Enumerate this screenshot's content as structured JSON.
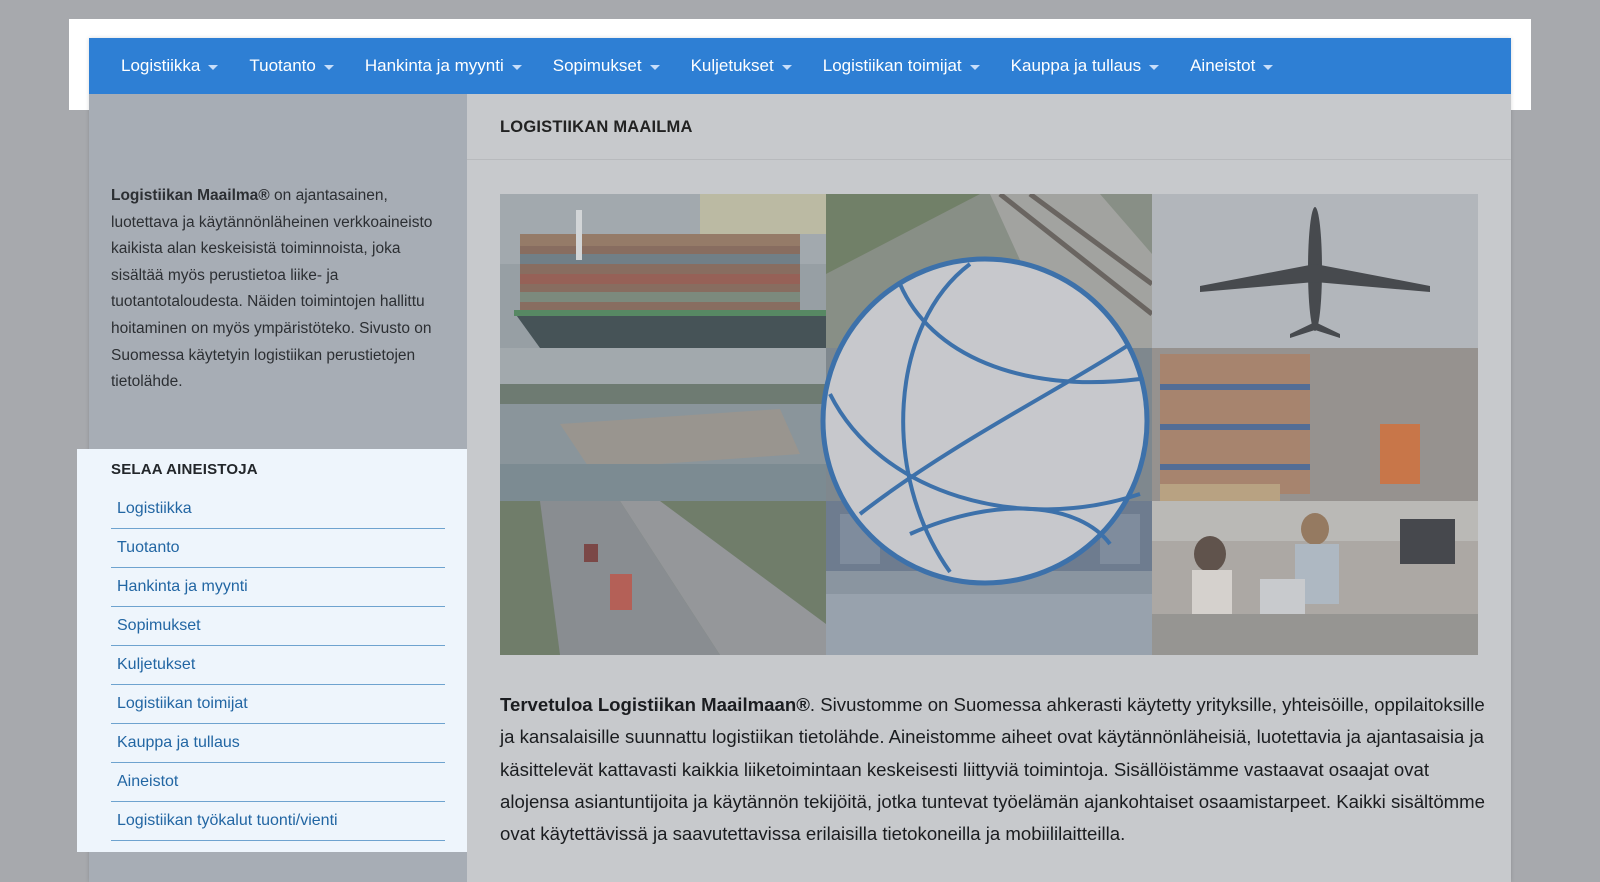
{
  "nav": {
    "items": [
      {
        "label": "Logistiikka"
      },
      {
        "label": "Tuotanto"
      },
      {
        "label": "Hankinta ja myynti"
      },
      {
        "label": "Sopimukset"
      },
      {
        "label": "Kuljetukset"
      },
      {
        "label": "Logistiikan toimijat"
      },
      {
        "label": "Kauppa ja tullaus"
      },
      {
        "label": "Aineistot"
      }
    ]
  },
  "sidebar": {
    "about_bold": "Logistiikan Maailma®",
    "about_rest": " on ajantasainen, luotettava ja käytännönläheinen verkkoaineisto kaikista alan keskeisistä toiminnoista, joka sisältää myös perustietoa liike- ja tuotantotaloudesta. Näiden toimintojen hallittu hoitaminen on myös ympäristöteko.  Sivusto on Suomessa käytetyin logistiikan perustietojen tietolähde.",
    "browse_title": "SELAA AINEISTOJA",
    "browse_items": [
      {
        "label": "Logistiikka"
      },
      {
        "label": "Tuotanto"
      },
      {
        "label": "Hankinta ja myynti"
      },
      {
        "label": "Sopimukset"
      },
      {
        "label": "Kuljetukset"
      },
      {
        "label": "Logistiikan toimijat"
      },
      {
        "label": "Kauppa ja tullaus"
      },
      {
        "label": "Aineistot"
      },
      {
        "label": "Logistiikan työkalut tuonti/vienti"
      }
    ]
  },
  "main": {
    "title": "LOGISTIIKAN MAAILMA",
    "intro_bold": "Tervetuloa Logistiikan Maailmaan®",
    "intro_rest": ". Sivustomme on Suomessa ahkerasti käytetty yrityksille, yhteisöille, oppilaitoksille ja kansalaisille suunnattu logistiikan tietolähde. Aineistomme aiheet ovat käytännönläheisiä, luotettavia ja ajantasaisia ja käsittelevät kattavasti kaikkia liiketoimintaan keskeisesti liittyviä toimintoja. Sisällöistämme vastaavat osaajat ovat alojensa asiantuntijoita ja käytännön tekijöitä, jotka tuntevat työelämän ajankohtaiset osaamistarpeet. Kaikki sisältömme ovat käytettävissä ja saavutettavissa erilaisilla tietokoneilla ja mobiililaitteilla."
  },
  "colors": {
    "nav_bg": "#2e7fd4",
    "link": "#2266a3",
    "globe": "#1f5fa3"
  },
  "hero_tiles": [
    "container-ship-image",
    "railway-image",
    "airplane-image",
    "port-aerial-image",
    "warehouse-image",
    "highway-trucks-image",
    "loading-dock-image",
    "office-workers-image"
  ]
}
